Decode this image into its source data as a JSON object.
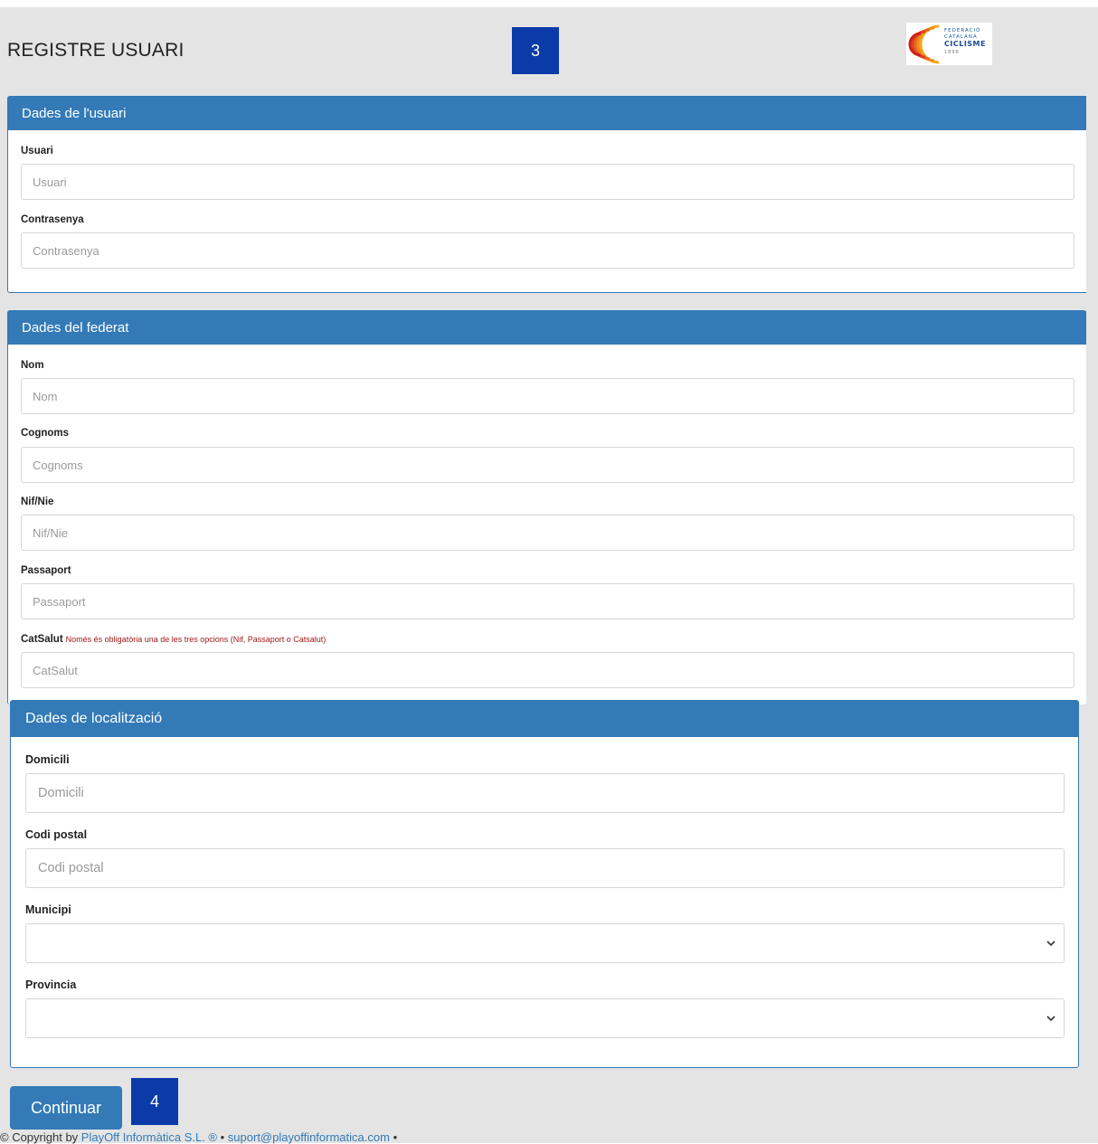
{
  "header": {
    "title": "REGISTRE USUARI"
  },
  "step_badges": {
    "top": "3",
    "bottom": "4"
  },
  "logo": {
    "line1": "FEDERACIÓ",
    "line2": "CATALANA",
    "line3": "CICLISME",
    "line4": "1896"
  },
  "panels": [
    {
      "heading": "Dades de l'usuari",
      "fields": [
        {
          "label": "Usuari",
          "placeholder": "Usuari"
        },
        {
          "label": "Contrasenya",
          "placeholder": "Contrasenya"
        }
      ]
    },
    {
      "heading": "Dades del federat",
      "fields": [
        {
          "label": "Nom",
          "placeholder": "Nom"
        },
        {
          "label": "Cognoms",
          "placeholder": "Cognoms"
        },
        {
          "label": "Nif/Nie",
          "placeholder": "Nif/Nie"
        },
        {
          "label": "Passaport",
          "placeholder": "Passaport"
        },
        {
          "label": "CatSalut",
          "placeholder": "CatSalut",
          "note": "Només és obligatòria una de les tres opcions (Nif, Passaport o Catsalut)"
        }
      ]
    },
    {
      "heading": "Dades de localització",
      "fields": [
        {
          "label": "Domicili",
          "placeholder": "Domicili"
        },
        {
          "label": "Codi postal",
          "placeholder": "Codi postal"
        },
        {
          "label": "Municipi",
          "value": ""
        },
        {
          "label": "Provincia",
          "value": ""
        }
      ]
    }
  ],
  "actions": {
    "continue_label": "Continuar"
  },
  "footer": {
    "prefix": "© Copyright by ",
    "company": "PlayOff Informàtica S.L. ®",
    "separator": " • ",
    "email": "suport@playoffinformatica.com",
    "trail": " •"
  },
  "colors": {
    "primary": "#337ab7",
    "badge": "#0a3ba8",
    "note": "#a01818"
  }
}
